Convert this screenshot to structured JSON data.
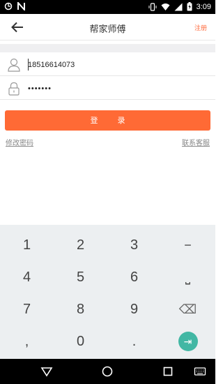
{
  "status_bar": {
    "time": "3:09",
    "icons": [
      "sync-icon",
      "notification-n-icon",
      "vibrate-icon",
      "wifi-icon",
      "signal-icon",
      "battery-icon"
    ]
  },
  "app_bar": {
    "title": "帮家师傅",
    "register_label": "注册",
    "back_icon": "back-arrow-icon"
  },
  "form": {
    "phone_value": "18516614073",
    "password_value": "•••••••",
    "phone_icon": "user-icon",
    "password_icon": "lock-icon"
  },
  "login_button": {
    "label": "登录"
  },
  "links": {
    "change_password": "修改密码",
    "contact_support": "联系客服"
  },
  "keyboard": {
    "rows": [
      [
        "1",
        "2",
        "3",
        "−"
      ],
      [
        "4",
        "5",
        "6",
        "⎵"
      ],
      [
        "7",
        "8",
        "9",
        "⌫"
      ],
      [
        ",",
        "0",
        ".",
        "⇥"
      ]
    ]
  },
  "nav_bar": {
    "icons": [
      "back-triangle-icon",
      "home-circle-icon",
      "recents-square-icon",
      "keyboard-switch-icon"
    ]
  },
  "colors": {
    "accent": "#ff6a35",
    "enter_key": "#42b7a4",
    "keyboard_bg": "#eceff1"
  }
}
